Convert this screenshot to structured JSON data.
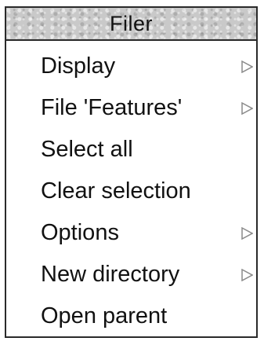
{
  "menu": {
    "title": "Filer",
    "items": [
      {
        "label": "Display",
        "submenu": true
      },
      {
        "label": "File 'Features'",
        "submenu": true
      },
      {
        "label": "Select all",
        "submenu": false
      },
      {
        "label": "Clear selection",
        "submenu": false
      },
      {
        "label": "Options",
        "submenu": true
      },
      {
        "label": "New directory",
        "submenu": true
      },
      {
        "label": "Open parent",
        "submenu": false
      }
    ]
  },
  "colors": {
    "title_bar": "#c9c9c9",
    "border": "#2a2a2a",
    "text": "#111111",
    "arrow": "#8a8a8a"
  },
  "icons": {
    "submenu": "triangle-right-icon"
  }
}
